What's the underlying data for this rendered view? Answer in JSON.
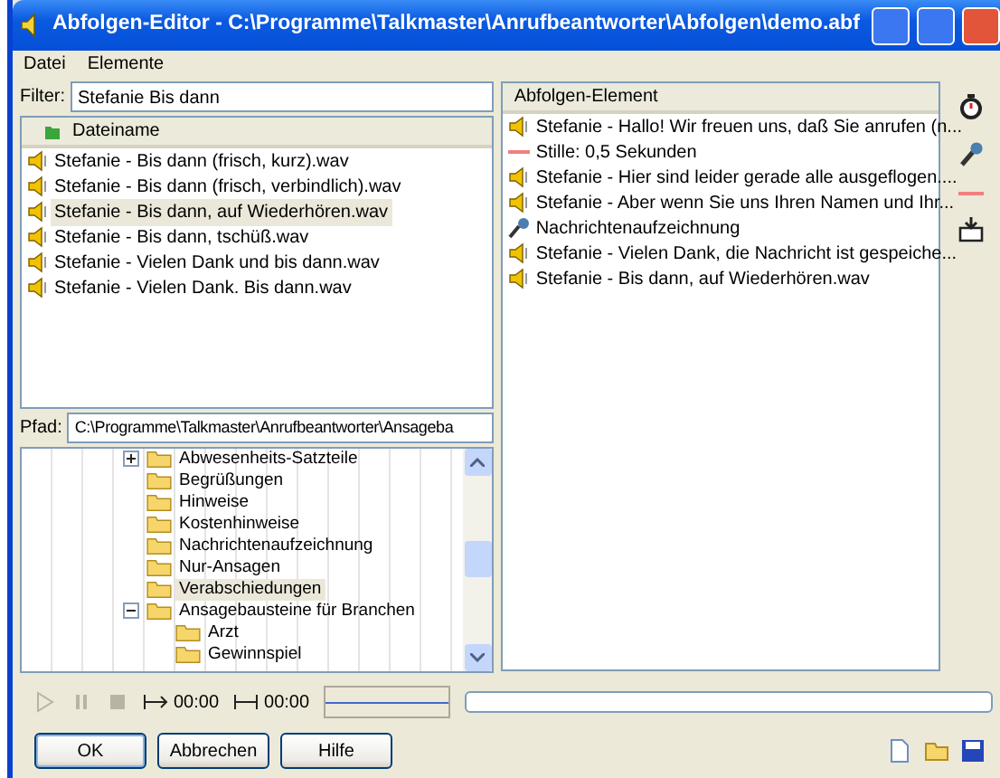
{
  "window": {
    "title": "Abfolgen-Editor - C:\\Programme\\Talkmaster\\Anrufbeantworter\\Abfolgen\\demo.abf"
  },
  "menu": [
    "Datei",
    "Elemente"
  ],
  "filter": {
    "label": "Filter:",
    "value": "Stefanie Bis dann"
  },
  "files": {
    "column": "Dateiname",
    "rows": [
      {
        "name": "Stefanie - Bis dann (frisch, kurz).wav",
        "selected": false
      },
      {
        "name": "Stefanie - Bis dann (frisch, verbindlich).wav",
        "selected": false
      },
      {
        "name": "Stefanie - Bis dann, auf Wiederhören.wav",
        "selected": true
      },
      {
        "name": "Stefanie - Bis dann, tschüß.wav",
        "selected": false
      },
      {
        "name": "Stefanie - Vielen Dank und bis dann.wav",
        "selected": false
      },
      {
        "name": "Stefanie - Vielen Dank. Bis dann.wav",
        "selected": false
      }
    ]
  },
  "path": {
    "label": "Pfad:",
    "value": "C:\\Programme\\Talkmaster\\Anrufbeantworter\\Ansageba"
  },
  "tree": [
    {
      "children": [
        {
          "label": "Abwesenheits-Satzteile",
          "expanded": false,
          "selected": false
        },
        {
          "label": "Begrüßungen",
          "selected": false
        },
        {
          "label": "Hinweise",
          "selected": false
        },
        {
          "label": "Kostenhinweise",
          "selected": false
        },
        {
          "label": "Nachrichtenaufzeichnung",
          "selected": false
        },
        {
          "label": "Nur-Ansagen",
          "selected": false
        },
        {
          "label": "Verabschiedungen",
          "selected": true
        }
      ]
    },
    {
      "label": "Ansagebausteine für Branchen",
      "expanded": true,
      "selected": false,
      "children": [
        {
          "label": "Arzt",
          "selected": false
        },
        {
          "label": "Gewinnspiel",
          "selected": false
        }
      ]
    }
  ],
  "sequence": {
    "column": "Abfolgen-Element",
    "items": [
      {
        "kind": "audio",
        "text": "Stefanie - Hallo! Wir freuen uns, daß Sie anrufen (n..."
      },
      {
        "kind": "silence",
        "text": "Stille: 0,5 Sekunden"
      },
      {
        "kind": "audio",
        "text": "Stefanie - Hier sind leider gerade alle ausgeflogen...."
      },
      {
        "kind": "audio",
        "text": "Stefanie - Aber wenn Sie uns Ihren Namen und Ihr..."
      },
      {
        "kind": "recording",
        "text": "Nachrichtenaufzeichnung"
      },
      {
        "kind": "audio",
        "text": "Stefanie - Vielen Dank, die Nachricht ist gespeiche..."
      },
      {
        "kind": "audio",
        "text": "Stefanie - Bis dann, auf Wiederhören.wav"
      }
    ]
  },
  "player": {
    "position": "00:00",
    "length": "00:00",
    "disabled": true,
    "level": 0
  },
  "buttons": [
    {
      "label": "OK",
      "default": true
    },
    {
      "label": "Abbrechen",
      "default": false
    },
    {
      "label": "Hilfe",
      "default": false
    }
  ]
}
